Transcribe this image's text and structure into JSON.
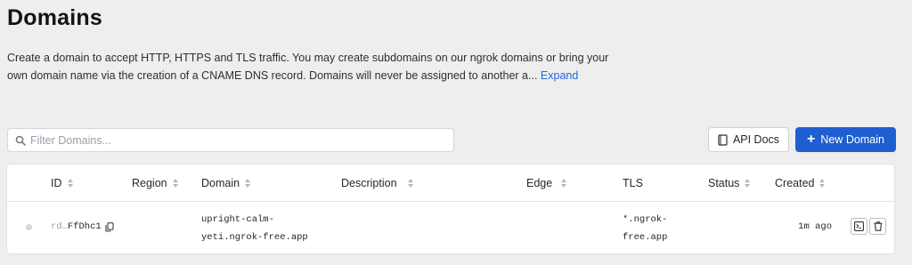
{
  "page": {
    "title": "Domains",
    "description": "Create a domain to accept HTTP, HTTPS and TLS traffic. You may create subdomains on our ngrok domains or bring your own domain name via the creation of a CNAME DNS record. Domains will never be assigned to another a...",
    "expand_label": "Expand"
  },
  "toolbar": {
    "filter_placeholder": "Filter Domains...",
    "filter_value": "",
    "api_docs_label": "API Docs",
    "new_domain_label": "New Domain"
  },
  "table": {
    "columns": [
      "ID",
      "Region",
      "Domain",
      "Description",
      "Edge",
      "TLS",
      "Status",
      "Created"
    ],
    "rows": [
      {
        "id_prefix": "rd…",
        "id_suffix": "FfDhc1",
        "region": "",
        "domain_line1": "upright-calm-",
        "domain_line2": "yeti.ngrok-free.app",
        "description": "",
        "edge": "",
        "tls_line1": "*.ngrok-",
        "tls_line2": "free.app",
        "status": "",
        "created": "1m ago"
      }
    ]
  },
  "colors": {
    "background": "#eeeeef",
    "primary": "#1f5ed1",
    "link": "#2a62d8"
  },
  "icons": [
    "search-icon",
    "book-icon",
    "plus-icon",
    "copy-icon",
    "terminal-icon",
    "trash-icon",
    "sort-icon"
  ]
}
